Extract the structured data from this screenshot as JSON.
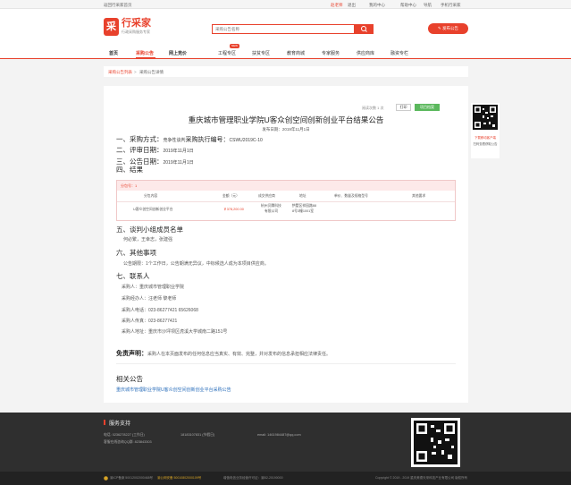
{
  "topbar": {
    "back_home": "返回行采家首页",
    "user": "赵老师",
    "exit": "退出",
    "my_center": "我的中心",
    "help": "帮助中心",
    "service_nav": "导航",
    "mobile": "手机行采家"
  },
  "header": {
    "logo_char": "采",
    "logo_name": "行采家",
    "logo_slogan": "行政采购服务专家",
    "search_placeholder": "采购公告名称",
    "publish_label": "发布公告"
  },
  "nav": {
    "items": [
      "首页",
      "采购公告",
      "网上竞价",
      "工程专区",
      "扶贫专区",
      "教育商城",
      "专家服务",
      "供应商库",
      "融资专栏"
    ],
    "new_badge": "NEW"
  },
  "breadcrumb": {
    "first": "采购公告列表",
    "sep": ">",
    "second": "采购公告详情"
  },
  "notice": {
    "read_count": "阅读次数 1 次",
    "print_label": "打印",
    "project_label": "项目档案",
    "title": "重庆城市管理职业学院U客众创空间创新创业平台结果公告",
    "pub_date": "发布日期：2019年11月1日",
    "s1_label": "一、采购方式：",
    "s1_method": "竞争性谈判",
    "s1_code_label": "采购执行编号：",
    "s1_code": "CSWU2019C-10",
    "s2_label": "二、评审日期：",
    "s2_value": "2019年11月1日",
    "s3_label": "三、公告日期：",
    "s3_value": "2019年11月1日",
    "s4_label": "四、结果",
    "package_label": "分包号：1",
    "table_headers": [
      "分包内容",
      "金额（元）",
      "成交供应商",
      "地址",
      "单价、数量及规格型号",
      "其他要求"
    ],
    "row": {
      "content": "U客众创空间创新创业平台",
      "amount": "￥378,200.00",
      "supplier_1": "杭州贝腾科技",
      "supplier_2": "有限公司",
      "address_1": "拱墅区祥园路88",
      "address_2": "8号3幢1001室"
    },
    "s5_label": "五、谈判小组成员名单",
    "s5_members": "何必繁，王幸志，张建强",
    "s6_label": "六、其他事项",
    "s6_text": "公告期限：1个工作日，公告期满无异议，中标候选人成为本项目供应商。",
    "s7_label": "七、联系人",
    "contacts": [
      "采购人：重庆城市管理职业学院",
      "采购经办人：汪老师 黎老师",
      "采购人电话：023-86277421 65626068",
      "采购人传真：023-86277421",
      "采购人地址：重庆市沙坪坝区虎溪大学城南二路151号"
    ],
    "disclaimer_label": "免责声明：",
    "disclaimer_text": "采购人在本页面发布的任何信息应当真实、有效、完整，并对发布的信息承担相应法律责任。",
    "related_title": "相关公告",
    "related_link": "重庆城市管理职业学院U客众创空间创新创业平台采购公告"
  },
  "side_qr": {
    "caption_1": "下载移动客户端",
    "caption_2": "扫码查看获取公告"
  },
  "footer": {
    "title": "服务支持",
    "phone": "电话: 0236278227 (工作日)",
    "qq": "客服在线咨询QQ群: 823843303",
    "hotline": "18183107831 (节假日)",
    "email": "email: 1461984487@qq.com"
  },
  "bottom": {
    "icp": "渝ICP备案 50012002000468号",
    "police": "渝公网安备 50010802000109号",
    "company_info": "增值电信业务经营许可证：渝B2-20190000",
    "copyright": "Copyright © 2019 - 2019 重庆美德天采科技产业有限公司 版权所有"
  },
  "colors": {
    "accent": "#e8412c",
    "green": "#5bb85d",
    "link": "#2a6ebb"
  }
}
